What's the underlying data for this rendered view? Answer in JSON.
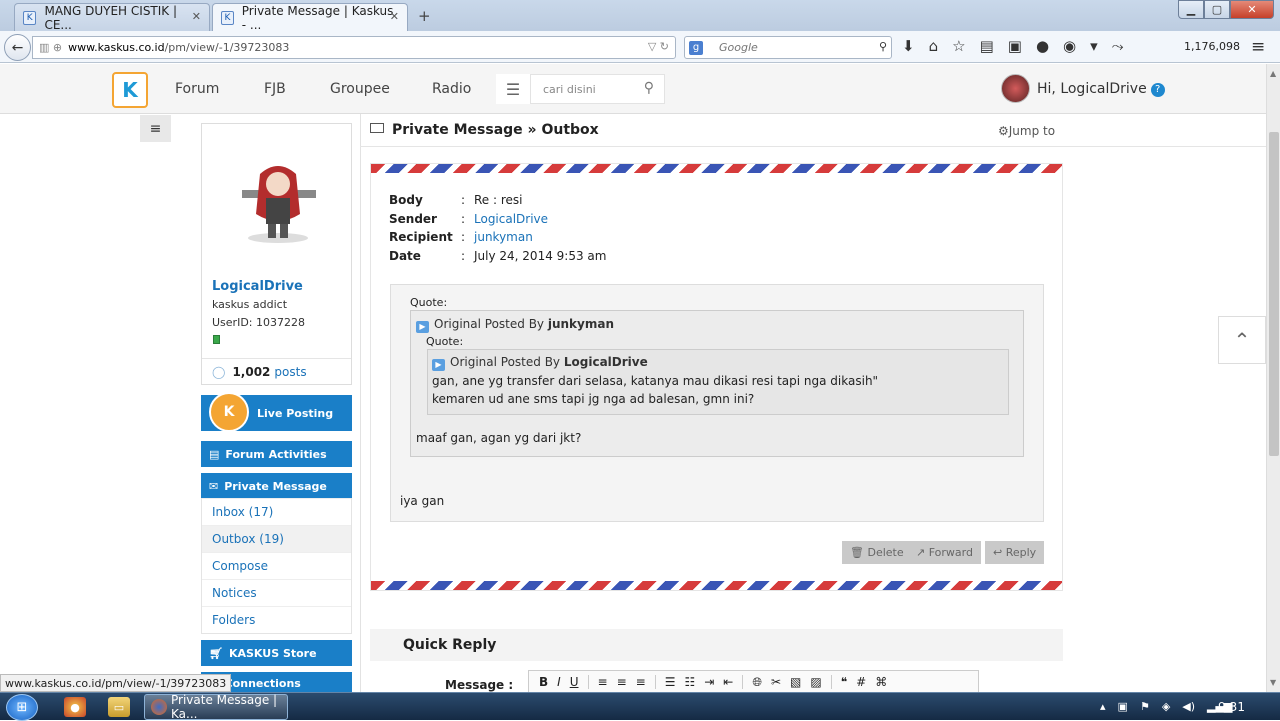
{
  "browser": {
    "tabs": [
      {
        "label": "MANG DUYEH CISTIK | CE..."
      },
      {
        "label": "Private Message | Kaskus - ..."
      }
    ],
    "url_host": "www.kaskus.co.id",
    "url_path": "/pm/view/-1/39723083",
    "search_placeholder": "Google",
    "counter": "1,176,098"
  },
  "site": {
    "nav": [
      "Forum",
      "FJB",
      "Groupee",
      "Radio"
    ],
    "search_placeholder": "cari disini",
    "greeting": "Hi, LogicalDrive"
  },
  "profile": {
    "username": "LogicalDrive",
    "rank": "kaskus addict",
    "userid": "UserID: 1037228",
    "posts_count": "1,002",
    "posts_label": "posts"
  },
  "sidebar": {
    "live_posting": "Live Posting",
    "forum_activities": "Forum Activities",
    "private_message": "Private Message",
    "pm_items": [
      "Inbox (17)",
      "Outbox (19)",
      "Compose",
      "Notices",
      "Folders"
    ],
    "store": "KASKUS Store",
    "connections": "Connections"
  },
  "content": {
    "title": "Private Message » Outbox",
    "jump_to": "Jump to",
    "meta": [
      {
        "key": "Body",
        "value": "Re : resi"
      },
      {
        "key": "Sender",
        "value": "LogicalDrive"
      },
      {
        "key": "Recipient",
        "value": "junkyman"
      },
      {
        "key": "Date",
        "value": "July 24, 2014 9:53 am"
      }
    ],
    "quote_label": "Quote:",
    "quote_outer": {
      "prefix": "Original Posted By",
      "author": "junkyman",
      "text": "maaf gan, agan yg dari jkt?"
    },
    "quote_inner": {
      "prefix": "Original Posted By",
      "author": "LogicalDrive",
      "line1": "gan, ane yg transfer dari selasa, katanya mau dikasi resi tapi nga dikasih\"",
      "line2": "kemaren ud ane sms tapi jg nga ad balesan, gmn ini?"
    },
    "reply_text": "iya gan",
    "actions": [
      "Delete",
      "Forward",
      "Reply"
    ],
    "quick_reply": "Quick Reply",
    "message_label": "Message :"
  },
  "status_url": "www.kaskus.co.id/pm/view/-1/39723083",
  "taskbar": {
    "task_label": "Private Message | Ka...",
    "time": "9:31"
  }
}
